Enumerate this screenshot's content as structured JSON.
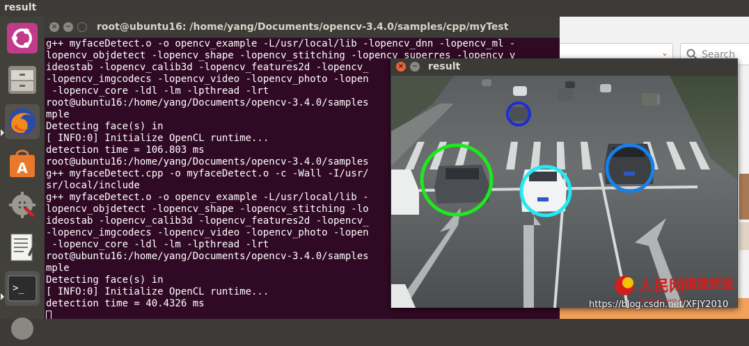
{
  "topbar": {
    "title": "result"
  },
  "launcher": {
    "items": [
      {
        "name": "ubuntu-dash-icon"
      },
      {
        "name": "files-icon"
      },
      {
        "name": "firefox-icon"
      },
      {
        "name": "software-center-icon"
      },
      {
        "name": "system-settings-icon"
      },
      {
        "name": "text-editor-icon"
      },
      {
        "name": "terminal-icon"
      }
    ]
  },
  "terminal": {
    "title": "root@ubuntu16: /home/yang/Documents/opencv-3.4.0/samples/cpp/myTest",
    "lines": [
      "g++ myfaceDetect.o -o opencv_example -L/usr/local/lib -lopencv_dnn -lopencv_ml -",
      "lopencv_objdetect -lopencv_shape -lopencv_stitching -lopencv_superres -lopencv_v",
      "ideostab -lopencv_calib3d -lopencv_features2d -lopencv_",
      "-lopencv_imgcodecs -lopencv_video -lopencv_photo -lopen",
      " -lopencv_core -ldl -lm -lpthread -lrt",
      "root@ubuntu16:/home/yang/Documents/opencv-3.4.0/samples",
      "mple",
      "Detecting face(s) in",
      "[ INFO:0] Initialize OpenCL runtime...",
      "detection time = 106.803 ms",
      "root@ubuntu16:/home/yang/Documents/opencv-3.4.0/samples",
      "g++ myfaceDetect.cpp -o myfaceDetect.o -c -Wall -I/usr/",
      "sr/local/include",
      "g++ myfaceDetect.o -o opencv_example -L/usr/local/lib -",
      "lopencv_objdetect -lopencv_shape -lopencv_stitching -lo",
      "ideostab -lopencv_calib3d -lopencv_features2d -lopencv_",
      "-lopencv_imgcodecs -lopencv_video -lopencv_photo -lopen",
      " -lopencv_core -ldl -lm -lpthread -lrt",
      "root@ubuntu16:/home/yang/Documents/opencv-3.4.0/samples",
      "mple",
      "Detecting face(s) in",
      "[ INFO:0] Initialize OpenCL runtime...",
      "detection time = 40.4326 ms",
      ""
    ]
  },
  "browser": {
    "search_placeholder": "Search"
  },
  "result_window": {
    "title": "result",
    "detections": [
      {
        "name": "detection-circle-green",
        "color": "#1ee81e"
      },
      {
        "name": "detection-circle-cyan",
        "color": "#25e8f5"
      },
      {
        "name": "detection-circle-blue",
        "color": "#1a7fe6"
      },
      {
        "name": "detection-circle-navy",
        "color": "#1e2cd6"
      }
    ],
    "logo_text": "人民网",
    "logo_sub_text": "福建频道",
    "logo_url_text": "fj.people.com.cn"
  },
  "watermark": "https://blog.csdn.net/XFJY2010"
}
